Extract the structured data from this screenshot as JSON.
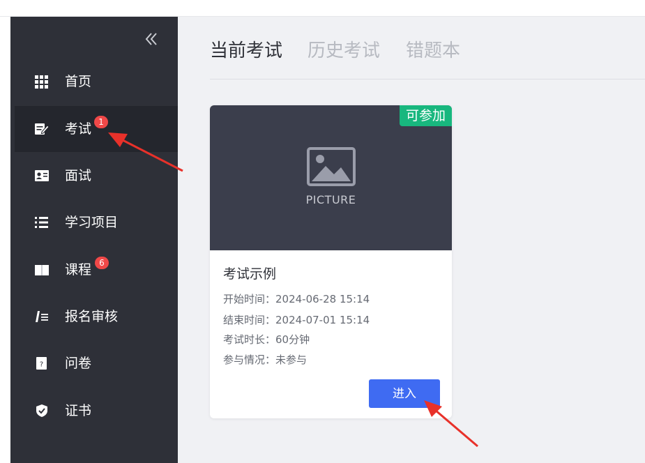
{
  "sidebar": {
    "items": [
      {
        "label": "首页",
        "icon": "grid-icon"
      },
      {
        "label": "考试",
        "icon": "exam-edit-icon",
        "badge": "1",
        "active": true
      },
      {
        "label": "面试",
        "icon": "interview-icon"
      },
      {
        "label": "学习项目",
        "icon": "list-icon"
      },
      {
        "label": "课程",
        "icon": "book-icon",
        "badge": "6"
      },
      {
        "label": "报名审核",
        "icon": "signup-review-icon"
      },
      {
        "label": "问卷",
        "icon": "questionnaire-icon"
      },
      {
        "label": "证书",
        "icon": "shield-icon"
      }
    ]
  },
  "tabs": [
    {
      "label": "当前考试",
      "active": true
    },
    {
      "label": "历史考试",
      "active": false
    },
    {
      "label": "错题本",
      "active": false
    }
  ],
  "card": {
    "status": "可参加",
    "picture_text": "PICTURE",
    "title": "考试示例",
    "start": "开始时间：2024-06-28 15:14",
    "end": "结束时间：2024-07-01 15:14",
    "duration": "考试时长：60分钟",
    "participation": "参与情况：未参与",
    "enter_label": "进入"
  },
  "colors": {
    "sidebar_bg": "#2e3038",
    "sidebar_active_bg": "#24262d",
    "badge": "#f04848",
    "main_bg": "#f0f1f4",
    "status_tag": "#18b77e",
    "enter_button": "#3f6bf2",
    "annotation_arrow": "#e8312a"
  }
}
